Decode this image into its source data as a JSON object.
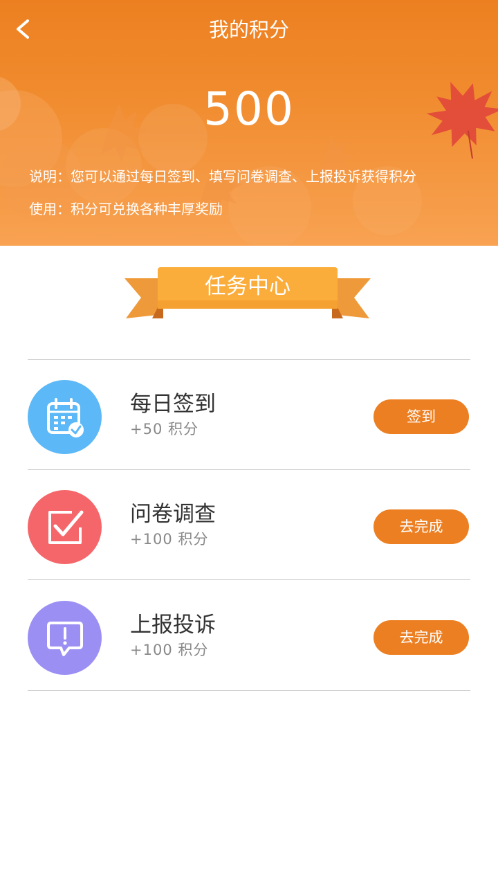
{
  "header": {
    "title": "我的积分",
    "back_icon": "chevron-left-icon",
    "points": "500",
    "description": "说明：您可以通过每日签到、填写问卷调查、上报投诉获得积分",
    "usage": "使用：积分可兑换各种丰厚奖励"
  },
  "section": {
    "title": "任务中心"
  },
  "tasks": [
    {
      "name": "每日签到",
      "reward": "+50 积分",
      "button": "签到",
      "icon": "calendar-check-icon",
      "color": "#5cb8f6"
    },
    {
      "name": "问卷调查",
      "reward": "+100 积分",
      "button": "去完成",
      "icon": "checkbox-icon",
      "color": "#f5666a"
    },
    {
      "name": "上报投诉",
      "reward": "+100 积分",
      "button": "去完成",
      "icon": "alert-message-icon",
      "color": "#9b8ff4"
    }
  ],
  "colors": {
    "accent": "#ec7f22",
    "divider": "#cfcfcf"
  }
}
